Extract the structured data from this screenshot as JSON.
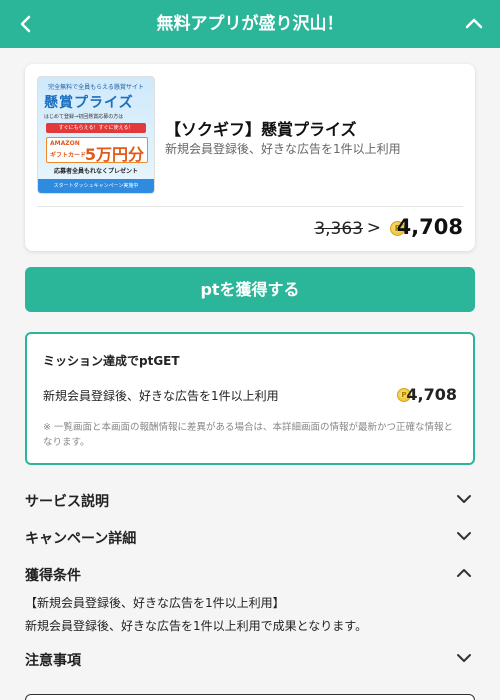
{
  "header": {
    "title": "無料アプリが盛り沢山！"
  },
  "offer": {
    "banner": {
      "top": "完全無料で全員もらえる懸賞サイト",
      "title": "懸賞プライズ",
      "sub": "はじめて登録→初回懸賞応募の方は",
      "red": "すぐにもらえる！すぐに使える！",
      "gift_brand": "AMAZON",
      "gift_card": "ギフトカード",
      "gift_amount": "5万円分",
      "present": "応募者全員もれなくプレゼント",
      "footer": "スタートダッシュキャンペーン実施中"
    },
    "name": "【ソクギフ】懸賞プライズ",
    "description": "新規会員登録後、好きな広告を1件以上利用",
    "old_points": "3,363",
    "arrow": ">",
    "coin_symbol": "P",
    "new_points": "4,708"
  },
  "get_button": {
    "label": "ptを獲得する"
  },
  "mission": {
    "title": "ミッション達成でptGET",
    "condition": "新規会員登録後、好きな広告を1件以上利用",
    "points": "4,708",
    "note": "※ 一覧画面と本画面の報酬情報に差異がある場合は、本詳細画面の情報が最新かつ正確な情報となります。"
  },
  "sections": {
    "service": "サービス説明",
    "campaign": "キャンペーン詳細",
    "conditions": "獲得条件",
    "notes": "注意事項"
  },
  "conditions_content": {
    "line1": "【新規会員登録後、好きな広告を1件以上利用】",
    "line2": "新規会員登録後、好きな広告を1件以上利用で成果となります。"
  },
  "colors": {
    "accent": "#2bb69a",
    "coin": "#e7b826"
  }
}
